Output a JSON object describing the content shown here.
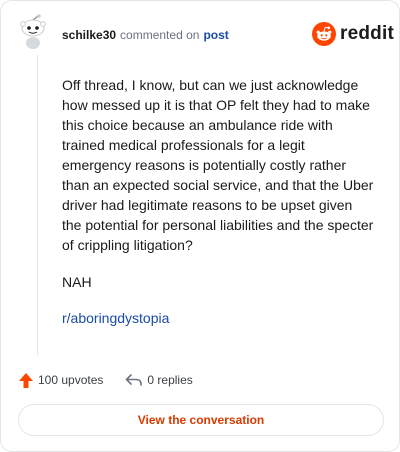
{
  "comment": {
    "username": "schilke30",
    "commented_text": "commented on",
    "post_link_label": "post",
    "body": "Off thread, I know, but can we just acknowledge how messed up it is that OP felt they had to make this choice because an ambulance ride with trained medical professionals for a legit emergency reasons is potentially costly rather than an expected social service, and that the Uber driver had legitimate reasons to be upset given the potential for personal liabilities and the specter of crippling litigation?",
    "verdict": "NAH",
    "subreddit": "r/aboringdystopia"
  },
  "brand": {
    "wordmark": "reddit",
    "accent_color": "#ff4500"
  },
  "actions": {
    "upvotes_label": "100 upvotes",
    "replies_label": "0 replies",
    "upvote_icon": "upvote-arrow-icon",
    "reply_icon": "reply-arrow-icon"
  },
  "cta": {
    "label": "View the conversation"
  }
}
